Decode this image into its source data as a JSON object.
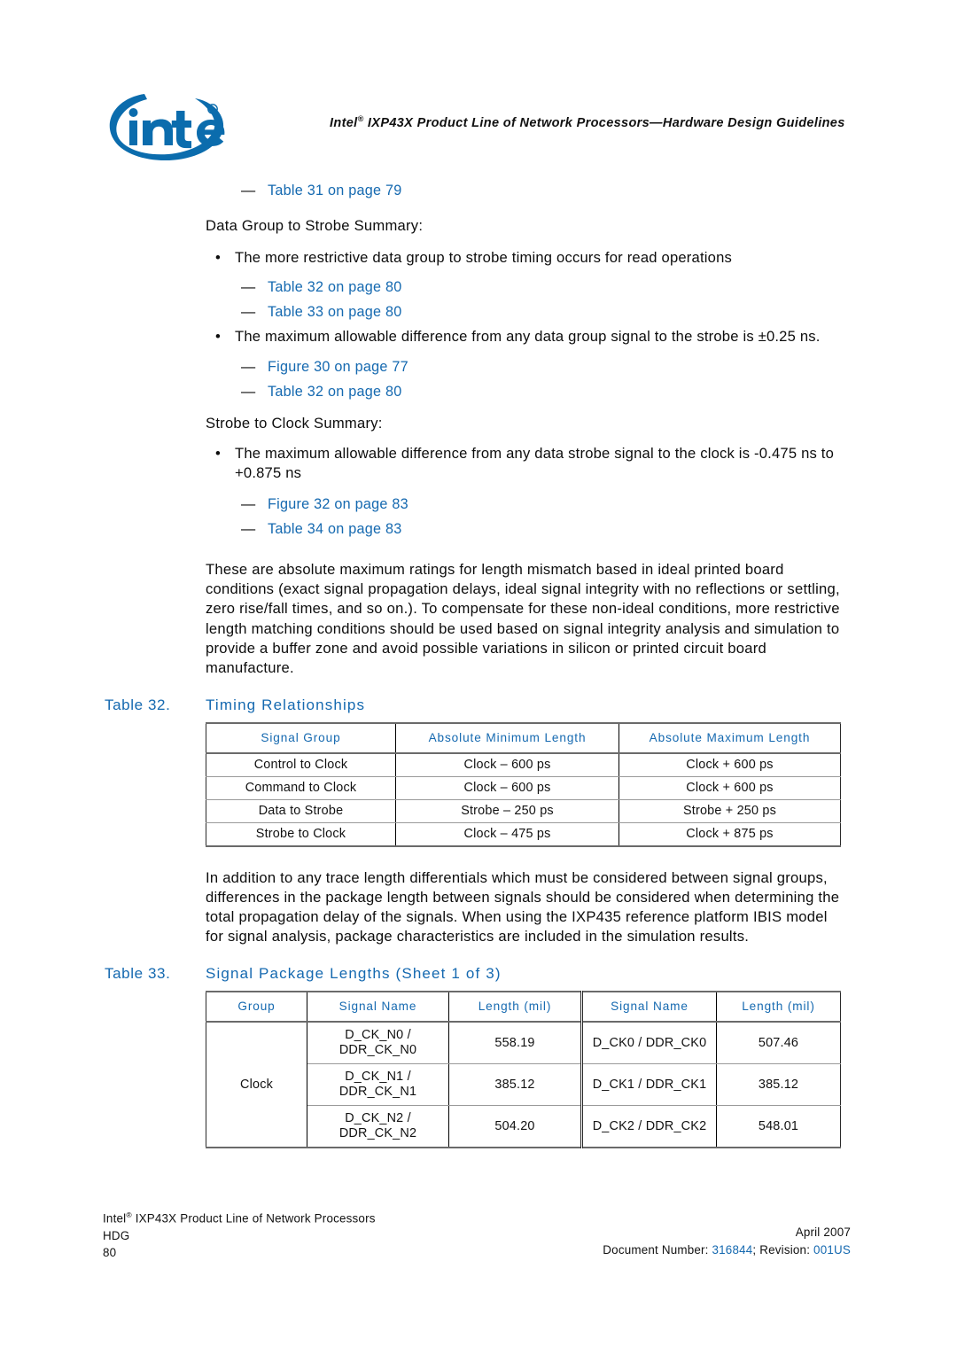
{
  "header": {
    "logo_alt": "Intel",
    "title_prefix": "Intel",
    "title_reg": "®",
    "title_rest": " IXP43X Product Line of Network Processors—Hardware Design Guidelines"
  },
  "body": {
    "xref_top": "Table 31 on page 79",
    "section1_heading": "Data Group to Strobe Summary:",
    "bullet1": "The more restrictive data group to strobe timing occurs for read operations",
    "bullet1_xrefs": [
      "Table 32 on page 80",
      "Table 33 on page 80"
    ],
    "bullet2": "The maximum allowable difference from any data group signal to the strobe is ±0.25 ns.",
    "bullet2_xrefs": [
      "Figure 30 on page 77",
      "Table 32 on page 80"
    ],
    "section2_heading": "Strobe to Clock Summary:",
    "bullet3": "The maximum allowable difference from any data strobe signal to the clock is -0.475 ns to +0.875 ns",
    "bullet3_xrefs": [
      "Figure 32 on page 83",
      "Table 34 on page 83"
    ],
    "paragraph1": "These are absolute maximum ratings for length mismatch based in ideal printed board conditions (exact signal propagation delays, ideal signal integrity with no reflections or settling, zero rise/fall times, and so on.). To compensate for these non-ideal conditions, more restrictive length matching conditions should be used based on signal integrity analysis and simulation to provide a buffer zone and avoid possible variations in silicon or printed circuit board manufacture.",
    "paragraph2": "In addition to any trace length differentials which must be considered between signal groups, differences in the package length between signals should be considered when determining the total propagation delay of the signals. When using the IXP435 reference platform IBIS model for signal analysis, package characteristics are included in the simulation results.",
    "dash": "—",
    "bullet_dot": "•"
  },
  "table32": {
    "caption_number": "Table 32.",
    "caption_title": "Timing Relationships",
    "columns": [
      "Signal Group",
      "Absolute Minimum Length",
      "Absolute Maximum Length"
    ],
    "rows": [
      [
        "Control to Clock",
        "Clock – 600 ps",
        "Clock + 600 ps"
      ],
      [
        "Command to Clock",
        "Clock – 600 ps",
        "Clock + 600 ps"
      ],
      [
        "Data to Strobe",
        "Strobe – 250 ps",
        "Strobe + 250 ps"
      ],
      [
        "Strobe to Clock",
        "Clock – 475 ps",
        "Clock + 875 ps"
      ]
    ]
  },
  "table33": {
    "caption_number": "Table 33.",
    "caption_title": "Signal Package Lengths (Sheet 1 of 3)",
    "columns": [
      "Group",
      "Signal Name",
      "Length (mil)",
      "Signal Name",
      "Length (mil)"
    ],
    "group_label": "Clock",
    "rows": [
      {
        "signal_a_line1": "D_CK_N0 /",
        "signal_a_line2": "DDR_CK_N0",
        "length_a": "558.19",
        "signal_b": "D_CK0 / DDR_CK0",
        "length_b": "507.46"
      },
      {
        "signal_a_line1": "D_CK_N1 /",
        "signal_a_line2": "DDR_CK_N1",
        "length_a": "385.12",
        "signal_b": "D_CK1 / DDR_CK1",
        "length_b": "385.12"
      },
      {
        "signal_a_line1": "D_CK_N2 /",
        "signal_a_line2": "DDR_CK_N2",
        "length_a": "504.20",
        "signal_b": "D_CK2 / DDR_CK2",
        "length_b": "548.01"
      }
    ]
  },
  "footer": {
    "left_line1_prefix": "Intel",
    "left_line1_reg": "®",
    "left_line1_rest": " IXP43X Product Line of Network Processors",
    "left_line2": "HDG",
    "page_number": "80",
    "date": "April 2007",
    "doc_label": "Document Number:",
    "doc_number": "316844",
    "rev_label": "; Revision:",
    "rev_number": "001US"
  },
  "colors": {
    "link_blue": "#1569b0",
    "intel_blue": "#0b6cad",
    "text_black": "#0d0d0d"
  }
}
